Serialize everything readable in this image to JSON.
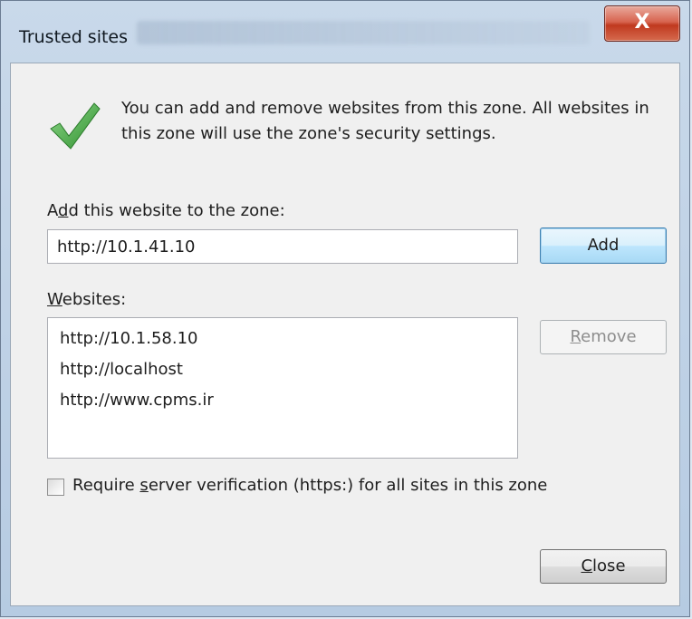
{
  "window": {
    "title": "Trusted sites",
    "close_glyph": "X"
  },
  "icons": {
    "check": "checkmark-icon",
    "close": "close-icon"
  },
  "intro_text": "You can add and remove websites from this zone. All websites in this zone will use the zone's security settings.",
  "add_section": {
    "label_pre": "A",
    "label_mnemonic": "d",
    "label_post": "d this website to the zone:",
    "input_value": "http://10.1.41.10",
    "add_button": "Add"
  },
  "websites": {
    "label_mnemonic": "W",
    "label_post": "ebsites:",
    "items": [
      "http://10.1.58.10",
      "http://localhost",
      "http://www.cpms.ir"
    ],
    "remove_mnemonic": "R",
    "remove_post": "emove"
  },
  "verification": {
    "label_pre": "Require ",
    "label_mnemonic": "s",
    "label_post": "erver verification (https:) for all sites in this zone",
    "checked": false
  },
  "footer": {
    "close_mnemonic": "C",
    "close_post": "lose"
  },
  "colors": {
    "check_green": "#3aa23a",
    "add_border": "#3c7fb1"
  }
}
